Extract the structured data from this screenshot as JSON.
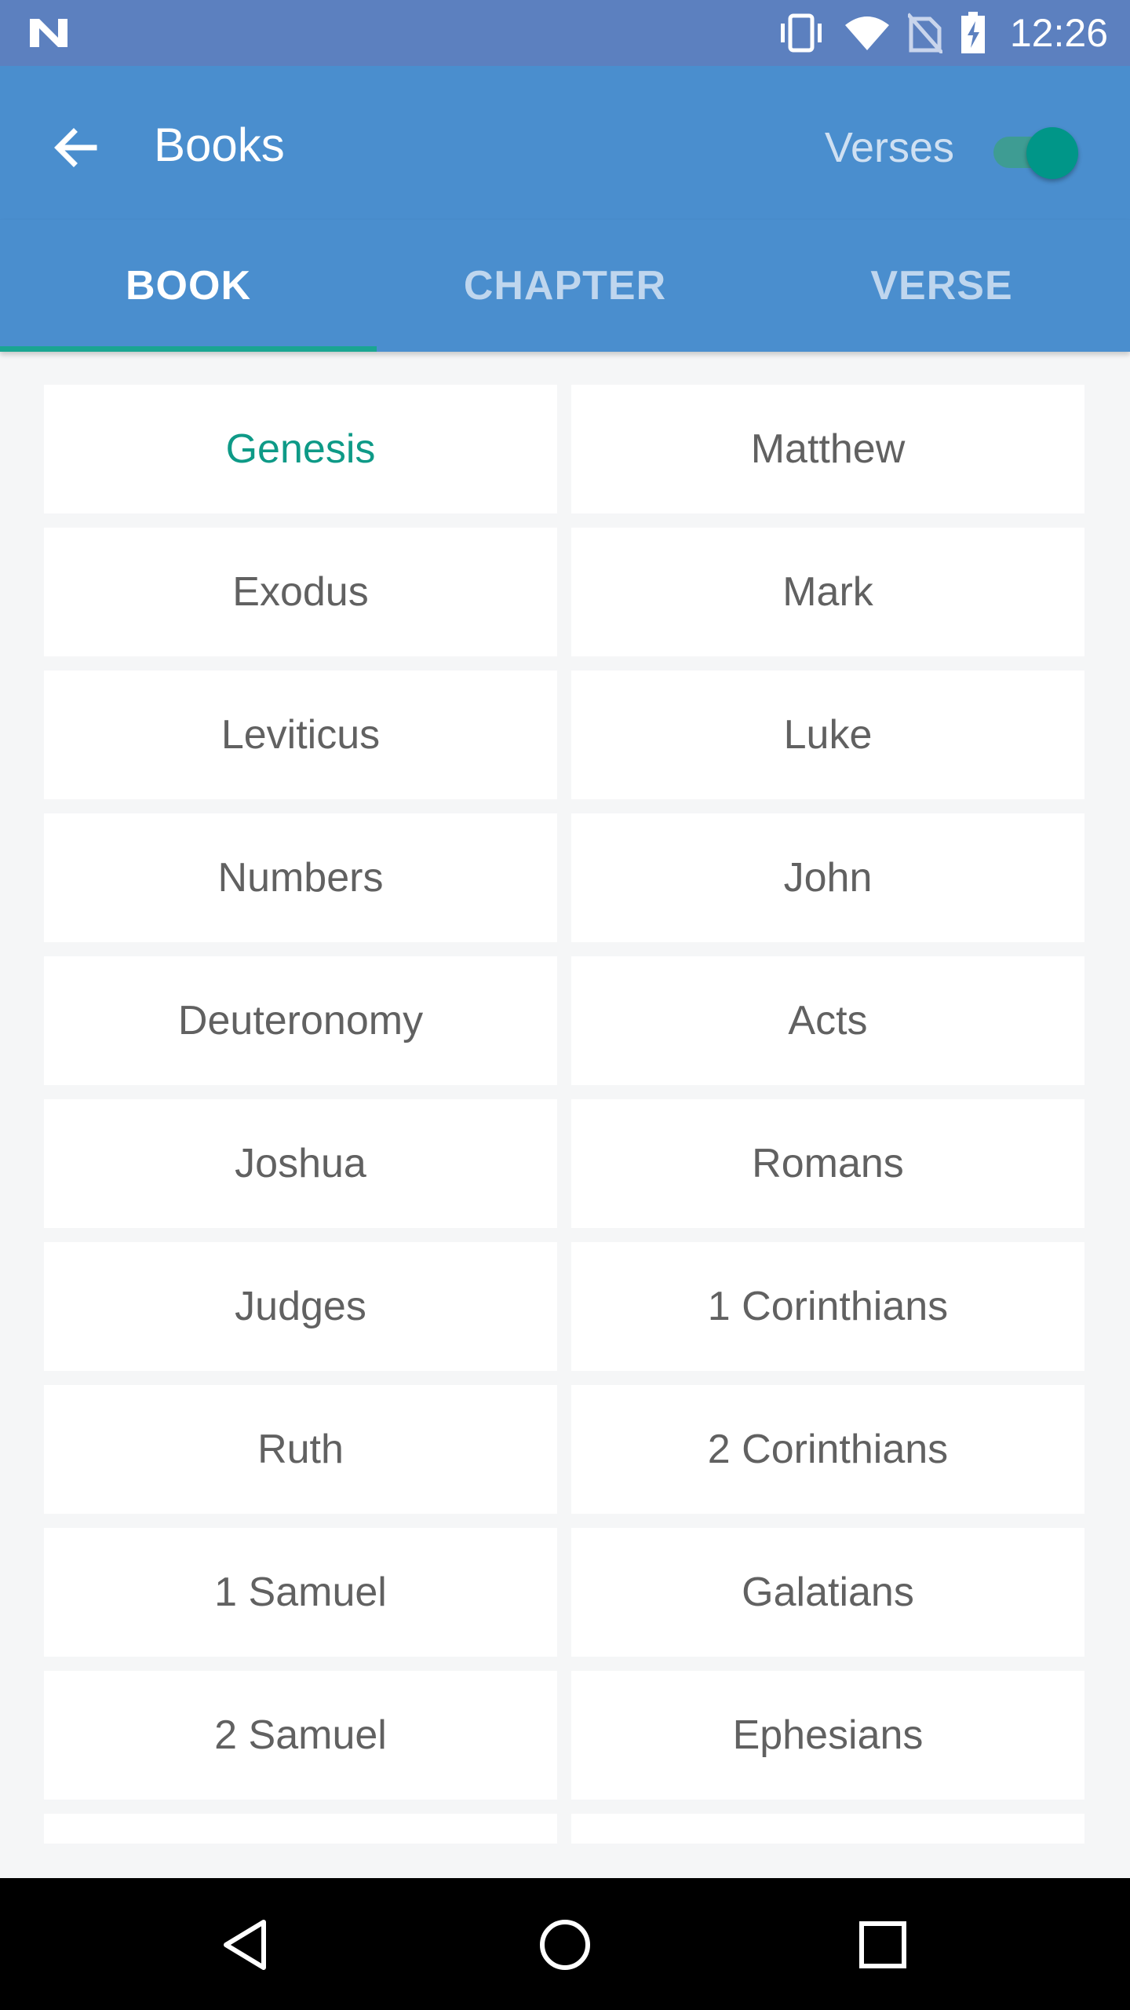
{
  "status_bar": {
    "time": "12:26",
    "icons": [
      "notification-n-icon",
      "vibrate-icon",
      "wifi-icon",
      "no-sim-icon",
      "battery-charging-icon"
    ]
  },
  "app_bar": {
    "back_icon": "arrow-back-icon",
    "title": "Books",
    "verses_label": "Verses",
    "verses_toggle_on": true
  },
  "tabs": [
    {
      "label": "BOOK",
      "active": true
    },
    {
      "label": "CHAPTER",
      "active": false
    },
    {
      "label": "VERSE",
      "active": false
    }
  ],
  "books": [
    {
      "label": "Genesis",
      "selected": true
    },
    {
      "label": "Matthew"
    },
    {
      "label": "Exodus"
    },
    {
      "label": "Mark"
    },
    {
      "label": "Leviticus"
    },
    {
      "label": "Luke"
    },
    {
      "label": "Numbers"
    },
    {
      "label": "John"
    },
    {
      "label": "Deuteronomy"
    },
    {
      "label": "Acts"
    },
    {
      "label": "Joshua"
    },
    {
      "label": "Romans"
    },
    {
      "label": "Judges"
    },
    {
      "label": "1 Corinthians"
    },
    {
      "label": "Ruth"
    },
    {
      "label": "2 Corinthians"
    },
    {
      "label": "1 Samuel"
    },
    {
      "label": "Galatians"
    },
    {
      "label": "2 Samuel"
    },
    {
      "label": "Ephesians"
    },
    {
      "label": ""
    },
    {
      "label": ""
    }
  ],
  "nav_bar": {
    "icons": [
      "back-triangle-icon",
      "home-circle-icon",
      "recents-square-icon"
    ]
  },
  "colors": {
    "status_bar": "#5C80BF",
    "app_bar": "#4A8ECE",
    "accent": "#0E9A87",
    "background": "#F5F6F7"
  }
}
